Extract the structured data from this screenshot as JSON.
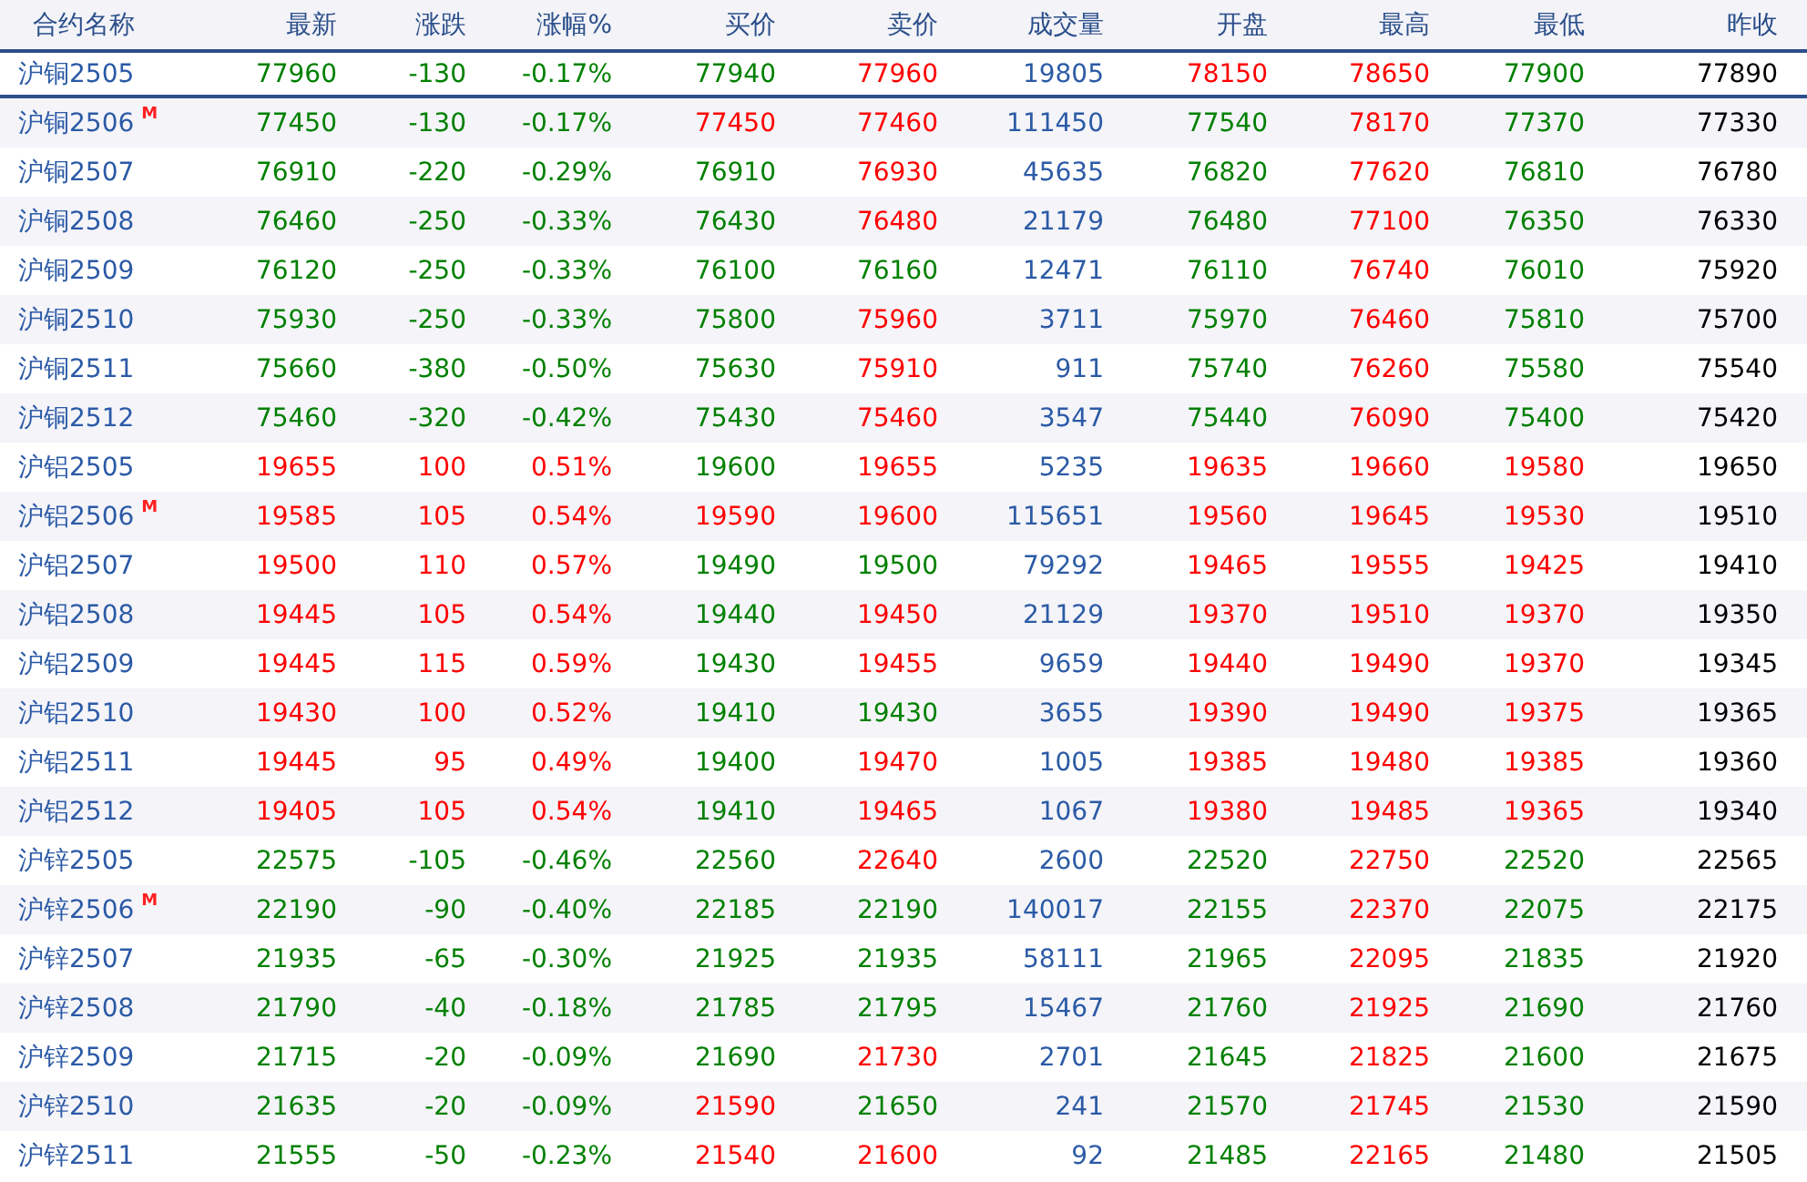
{
  "table": {
    "columns": [
      "合约名称",
      "最新",
      "涨跌",
      "涨幅%",
      "买价",
      "卖价",
      "成交量",
      "开盘",
      "最高",
      "最低",
      "昨收"
    ],
    "rows": [
      {
        "selected": true,
        "cells": [
          {
            "text": "沪铜2505",
            "color": "#2b5aa6"
          },
          {
            "text": "77960",
            "color": "#008000"
          },
          {
            "text": "-130",
            "color": "#008000"
          },
          {
            "text": "-0.17%",
            "color": "#008000"
          },
          {
            "text": "77940",
            "color": "#008000"
          },
          {
            "text": "77960",
            "color": "#ff0000"
          },
          {
            "text": "19805",
            "color": "#2b5aa6"
          },
          {
            "text": "78150",
            "color": "#ff0000"
          },
          {
            "text": "78650",
            "color": "#ff0000"
          },
          {
            "text": "77900",
            "color": "#008000"
          },
          {
            "text": "77890",
            "color": "#000000"
          }
        ]
      },
      {
        "marker": "M",
        "selected": false,
        "cells": [
          {
            "text": "沪铜2506",
            "color": "#2b5aa6"
          },
          {
            "text": "77450",
            "color": "#008000"
          },
          {
            "text": "-130",
            "color": "#008000"
          },
          {
            "text": "-0.17%",
            "color": "#008000"
          },
          {
            "text": "77450",
            "color": "#ff0000"
          },
          {
            "text": "77460",
            "color": "#ff0000"
          },
          {
            "text": "111450",
            "color": "#2b5aa6"
          },
          {
            "text": "77540",
            "color": "#008000"
          },
          {
            "text": "78170",
            "color": "#ff0000"
          },
          {
            "text": "77370",
            "color": "#008000"
          },
          {
            "text": "77330",
            "color": "#000000"
          }
        ]
      },
      {
        "selected": false,
        "cells": [
          {
            "text": "沪铜2507",
            "color": "#2b5aa6"
          },
          {
            "text": "76910",
            "color": "#008000"
          },
          {
            "text": "-220",
            "color": "#008000"
          },
          {
            "text": "-0.29%",
            "color": "#008000"
          },
          {
            "text": "76910",
            "color": "#008000"
          },
          {
            "text": "76930",
            "color": "#ff0000"
          },
          {
            "text": "45635",
            "color": "#2b5aa6"
          },
          {
            "text": "76820",
            "color": "#008000"
          },
          {
            "text": "77620",
            "color": "#ff0000"
          },
          {
            "text": "76810",
            "color": "#008000"
          },
          {
            "text": "76780",
            "color": "#000000"
          }
        ]
      },
      {
        "selected": false,
        "cells": [
          {
            "text": "沪铜2508",
            "color": "#2b5aa6"
          },
          {
            "text": "76460",
            "color": "#008000"
          },
          {
            "text": "-250",
            "color": "#008000"
          },
          {
            "text": "-0.33%",
            "color": "#008000"
          },
          {
            "text": "76430",
            "color": "#008000"
          },
          {
            "text": "76480",
            "color": "#ff0000"
          },
          {
            "text": "21179",
            "color": "#2b5aa6"
          },
          {
            "text": "76480",
            "color": "#008000"
          },
          {
            "text": "77100",
            "color": "#ff0000"
          },
          {
            "text": "76350",
            "color": "#008000"
          },
          {
            "text": "76330",
            "color": "#000000"
          }
        ]
      },
      {
        "selected": false,
        "cells": [
          {
            "text": "沪铜2509",
            "color": "#2b5aa6"
          },
          {
            "text": "76120",
            "color": "#008000"
          },
          {
            "text": "-250",
            "color": "#008000"
          },
          {
            "text": "-0.33%",
            "color": "#008000"
          },
          {
            "text": "76100",
            "color": "#008000"
          },
          {
            "text": "76160",
            "color": "#008000"
          },
          {
            "text": "12471",
            "color": "#2b5aa6"
          },
          {
            "text": "76110",
            "color": "#008000"
          },
          {
            "text": "76740",
            "color": "#ff0000"
          },
          {
            "text": "76010",
            "color": "#008000"
          },
          {
            "text": "75920",
            "color": "#000000"
          }
        ]
      },
      {
        "selected": false,
        "cells": [
          {
            "text": "沪铜2510",
            "color": "#2b5aa6"
          },
          {
            "text": "75930",
            "color": "#008000"
          },
          {
            "text": "-250",
            "color": "#008000"
          },
          {
            "text": "-0.33%",
            "color": "#008000"
          },
          {
            "text": "75800",
            "color": "#008000"
          },
          {
            "text": "75960",
            "color": "#ff0000"
          },
          {
            "text": "3711",
            "color": "#2b5aa6"
          },
          {
            "text": "75970",
            "color": "#008000"
          },
          {
            "text": "76460",
            "color": "#ff0000"
          },
          {
            "text": "75810",
            "color": "#008000"
          },
          {
            "text": "75700",
            "color": "#000000"
          }
        ]
      },
      {
        "selected": false,
        "cells": [
          {
            "text": "沪铜2511",
            "color": "#2b5aa6"
          },
          {
            "text": "75660",
            "color": "#008000"
          },
          {
            "text": "-380",
            "color": "#008000"
          },
          {
            "text": "-0.50%",
            "color": "#008000"
          },
          {
            "text": "75630",
            "color": "#008000"
          },
          {
            "text": "75910",
            "color": "#ff0000"
          },
          {
            "text": "911",
            "color": "#2b5aa6"
          },
          {
            "text": "75740",
            "color": "#008000"
          },
          {
            "text": "76260",
            "color": "#ff0000"
          },
          {
            "text": "75580",
            "color": "#008000"
          },
          {
            "text": "75540",
            "color": "#000000"
          }
        ]
      },
      {
        "selected": false,
        "cells": [
          {
            "text": "沪铜2512",
            "color": "#2b5aa6"
          },
          {
            "text": "75460",
            "color": "#008000"
          },
          {
            "text": "-320",
            "color": "#008000"
          },
          {
            "text": "-0.42%",
            "color": "#008000"
          },
          {
            "text": "75430",
            "color": "#008000"
          },
          {
            "text": "75460",
            "color": "#ff0000"
          },
          {
            "text": "3547",
            "color": "#2b5aa6"
          },
          {
            "text": "75440",
            "color": "#008000"
          },
          {
            "text": "76090",
            "color": "#ff0000"
          },
          {
            "text": "75400",
            "color": "#008000"
          },
          {
            "text": "75420",
            "color": "#000000"
          }
        ]
      },
      {
        "selected": false,
        "cells": [
          {
            "text": "沪铝2505",
            "color": "#2b5aa6"
          },
          {
            "text": "19655",
            "color": "#ff0000"
          },
          {
            "text": "100",
            "color": "#ff0000"
          },
          {
            "text": "0.51%",
            "color": "#ff0000"
          },
          {
            "text": "19600",
            "color": "#008000"
          },
          {
            "text": "19655",
            "color": "#ff0000"
          },
          {
            "text": "5235",
            "color": "#2b5aa6"
          },
          {
            "text": "19635",
            "color": "#ff0000"
          },
          {
            "text": "19660",
            "color": "#ff0000"
          },
          {
            "text": "19580",
            "color": "#ff0000"
          },
          {
            "text": "19650",
            "color": "#000000"
          }
        ]
      },
      {
        "marker": "M",
        "selected": false,
        "cells": [
          {
            "text": "沪铝2506",
            "color": "#2b5aa6"
          },
          {
            "text": "19585",
            "color": "#ff0000"
          },
          {
            "text": "105",
            "color": "#ff0000"
          },
          {
            "text": "0.54%",
            "color": "#ff0000"
          },
          {
            "text": "19590",
            "color": "#ff0000"
          },
          {
            "text": "19600",
            "color": "#ff0000"
          },
          {
            "text": "115651",
            "color": "#2b5aa6"
          },
          {
            "text": "19560",
            "color": "#ff0000"
          },
          {
            "text": "19645",
            "color": "#ff0000"
          },
          {
            "text": "19530",
            "color": "#ff0000"
          },
          {
            "text": "19510",
            "color": "#000000"
          }
        ]
      },
      {
        "selected": false,
        "cells": [
          {
            "text": "沪铝2507",
            "color": "#2b5aa6"
          },
          {
            "text": "19500",
            "color": "#ff0000"
          },
          {
            "text": "110",
            "color": "#ff0000"
          },
          {
            "text": "0.57%",
            "color": "#ff0000"
          },
          {
            "text": "19490",
            "color": "#008000"
          },
          {
            "text": "19500",
            "color": "#008000"
          },
          {
            "text": "79292",
            "color": "#2b5aa6"
          },
          {
            "text": "19465",
            "color": "#ff0000"
          },
          {
            "text": "19555",
            "color": "#ff0000"
          },
          {
            "text": "19425",
            "color": "#ff0000"
          },
          {
            "text": "19410",
            "color": "#000000"
          }
        ]
      },
      {
        "selected": false,
        "cells": [
          {
            "text": "沪铝2508",
            "color": "#2b5aa6"
          },
          {
            "text": "19445",
            "color": "#ff0000"
          },
          {
            "text": "105",
            "color": "#ff0000"
          },
          {
            "text": "0.54%",
            "color": "#ff0000"
          },
          {
            "text": "19440",
            "color": "#008000"
          },
          {
            "text": "19450",
            "color": "#ff0000"
          },
          {
            "text": "21129",
            "color": "#2b5aa6"
          },
          {
            "text": "19370",
            "color": "#ff0000"
          },
          {
            "text": "19510",
            "color": "#ff0000"
          },
          {
            "text": "19370",
            "color": "#ff0000"
          },
          {
            "text": "19350",
            "color": "#000000"
          }
        ]
      },
      {
        "selected": false,
        "cells": [
          {
            "text": "沪铝2509",
            "color": "#2b5aa6"
          },
          {
            "text": "19445",
            "color": "#ff0000"
          },
          {
            "text": "115",
            "color": "#ff0000"
          },
          {
            "text": "0.59%",
            "color": "#ff0000"
          },
          {
            "text": "19430",
            "color": "#008000"
          },
          {
            "text": "19455",
            "color": "#ff0000"
          },
          {
            "text": "9659",
            "color": "#2b5aa6"
          },
          {
            "text": "19440",
            "color": "#ff0000"
          },
          {
            "text": "19490",
            "color": "#ff0000"
          },
          {
            "text": "19370",
            "color": "#ff0000"
          },
          {
            "text": "19345",
            "color": "#000000"
          }
        ]
      },
      {
        "selected": false,
        "cells": [
          {
            "text": "沪铝2510",
            "color": "#2b5aa6"
          },
          {
            "text": "19430",
            "color": "#ff0000"
          },
          {
            "text": "100",
            "color": "#ff0000"
          },
          {
            "text": "0.52%",
            "color": "#ff0000"
          },
          {
            "text": "19410",
            "color": "#008000"
          },
          {
            "text": "19430",
            "color": "#008000"
          },
          {
            "text": "3655",
            "color": "#2b5aa6"
          },
          {
            "text": "19390",
            "color": "#ff0000"
          },
          {
            "text": "19490",
            "color": "#ff0000"
          },
          {
            "text": "19375",
            "color": "#ff0000"
          },
          {
            "text": "19365",
            "color": "#000000"
          }
        ]
      },
      {
        "selected": false,
        "cells": [
          {
            "text": "沪铝2511",
            "color": "#2b5aa6"
          },
          {
            "text": "19445",
            "color": "#ff0000"
          },
          {
            "text": "95",
            "color": "#ff0000"
          },
          {
            "text": "0.49%",
            "color": "#ff0000"
          },
          {
            "text": "19400",
            "color": "#008000"
          },
          {
            "text": "19470",
            "color": "#ff0000"
          },
          {
            "text": "1005",
            "color": "#2b5aa6"
          },
          {
            "text": "19385",
            "color": "#ff0000"
          },
          {
            "text": "19480",
            "color": "#ff0000"
          },
          {
            "text": "19385",
            "color": "#ff0000"
          },
          {
            "text": "19360",
            "color": "#000000"
          }
        ]
      },
      {
        "selected": false,
        "cells": [
          {
            "text": "沪铝2512",
            "color": "#2b5aa6"
          },
          {
            "text": "19405",
            "color": "#ff0000"
          },
          {
            "text": "105",
            "color": "#ff0000"
          },
          {
            "text": "0.54%",
            "color": "#ff0000"
          },
          {
            "text": "19410",
            "color": "#008000"
          },
          {
            "text": "19465",
            "color": "#ff0000"
          },
          {
            "text": "1067",
            "color": "#2b5aa6"
          },
          {
            "text": "19380",
            "color": "#ff0000"
          },
          {
            "text": "19485",
            "color": "#ff0000"
          },
          {
            "text": "19365",
            "color": "#ff0000"
          },
          {
            "text": "19340",
            "color": "#000000"
          }
        ]
      },
      {
        "selected": false,
        "cells": [
          {
            "text": "沪锌2505",
            "color": "#2b5aa6"
          },
          {
            "text": "22575",
            "color": "#008000"
          },
          {
            "text": "-105",
            "color": "#008000"
          },
          {
            "text": "-0.46%",
            "color": "#008000"
          },
          {
            "text": "22560",
            "color": "#008000"
          },
          {
            "text": "22640",
            "color": "#ff0000"
          },
          {
            "text": "2600",
            "color": "#2b5aa6"
          },
          {
            "text": "22520",
            "color": "#008000"
          },
          {
            "text": "22750",
            "color": "#ff0000"
          },
          {
            "text": "22520",
            "color": "#008000"
          },
          {
            "text": "22565",
            "color": "#000000"
          }
        ]
      },
      {
        "marker": "M",
        "selected": false,
        "cells": [
          {
            "text": "沪锌2506",
            "color": "#2b5aa6"
          },
          {
            "text": "22190",
            "color": "#008000"
          },
          {
            "text": "-90",
            "color": "#008000"
          },
          {
            "text": "-0.40%",
            "color": "#008000"
          },
          {
            "text": "22185",
            "color": "#008000"
          },
          {
            "text": "22190",
            "color": "#008000"
          },
          {
            "text": "140017",
            "color": "#2b5aa6"
          },
          {
            "text": "22155",
            "color": "#008000"
          },
          {
            "text": "22370",
            "color": "#ff0000"
          },
          {
            "text": "22075",
            "color": "#008000"
          },
          {
            "text": "22175",
            "color": "#000000"
          }
        ]
      },
      {
        "selected": false,
        "cells": [
          {
            "text": "沪锌2507",
            "color": "#2b5aa6"
          },
          {
            "text": "21935",
            "color": "#008000"
          },
          {
            "text": "-65",
            "color": "#008000"
          },
          {
            "text": "-0.30%",
            "color": "#008000"
          },
          {
            "text": "21925",
            "color": "#008000"
          },
          {
            "text": "21935",
            "color": "#008000"
          },
          {
            "text": "58111",
            "color": "#2b5aa6"
          },
          {
            "text": "21965",
            "color": "#008000"
          },
          {
            "text": "22095",
            "color": "#ff0000"
          },
          {
            "text": "21835",
            "color": "#008000"
          },
          {
            "text": "21920",
            "color": "#000000"
          }
        ]
      },
      {
        "selected": false,
        "cells": [
          {
            "text": "沪锌2508",
            "color": "#2b5aa6"
          },
          {
            "text": "21790",
            "color": "#008000"
          },
          {
            "text": "-40",
            "color": "#008000"
          },
          {
            "text": "-0.18%",
            "color": "#008000"
          },
          {
            "text": "21785",
            "color": "#008000"
          },
          {
            "text": "21795",
            "color": "#008000"
          },
          {
            "text": "15467",
            "color": "#2b5aa6"
          },
          {
            "text": "21760",
            "color": "#008000"
          },
          {
            "text": "21925",
            "color": "#ff0000"
          },
          {
            "text": "21690",
            "color": "#008000"
          },
          {
            "text": "21760",
            "color": "#000000"
          }
        ]
      },
      {
        "selected": false,
        "cells": [
          {
            "text": "沪锌2509",
            "color": "#2b5aa6"
          },
          {
            "text": "21715",
            "color": "#008000"
          },
          {
            "text": "-20",
            "color": "#008000"
          },
          {
            "text": "-0.09%",
            "color": "#008000"
          },
          {
            "text": "21690",
            "color": "#008000"
          },
          {
            "text": "21730",
            "color": "#ff0000"
          },
          {
            "text": "2701",
            "color": "#2b5aa6"
          },
          {
            "text": "21645",
            "color": "#008000"
          },
          {
            "text": "21825",
            "color": "#ff0000"
          },
          {
            "text": "21600",
            "color": "#008000"
          },
          {
            "text": "21675",
            "color": "#000000"
          }
        ]
      },
      {
        "selected": false,
        "cells": [
          {
            "text": "沪锌2510",
            "color": "#2b5aa6"
          },
          {
            "text": "21635",
            "color": "#008000"
          },
          {
            "text": "-20",
            "color": "#008000"
          },
          {
            "text": "-0.09%",
            "color": "#008000"
          },
          {
            "text": "21590",
            "color": "#ff0000"
          },
          {
            "text": "21650",
            "color": "#008000"
          },
          {
            "text": "241",
            "color": "#2b5aa6"
          },
          {
            "text": "21570",
            "color": "#008000"
          },
          {
            "text": "21745",
            "color": "#ff0000"
          },
          {
            "text": "21530",
            "color": "#008000"
          },
          {
            "text": "21590",
            "color": "#000000"
          }
        ]
      },
      {
        "selected": false,
        "cells": [
          {
            "text": "沪锌2511",
            "color": "#2b5aa6"
          },
          {
            "text": "21555",
            "color": "#008000"
          },
          {
            "text": "-50",
            "color": "#008000"
          },
          {
            "text": "-0.23%",
            "color": "#008000"
          },
          {
            "text": "21540",
            "color": "#ff0000"
          },
          {
            "text": "21600",
            "color": "#ff0000"
          },
          {
            "text": "92",
            "color": "#2b5aa6"
          },
          {
            "text": "21485",
            "color": "#008000"
          },
          {
            "text": "22165",
            "color": "#ff0000"
          },
          {
            "text": "21480",
            "color": "#008000"
          },
          {
            "text": "21505",
            "color": "#000000"
          }
        ]
      }
    ]
  }
}
